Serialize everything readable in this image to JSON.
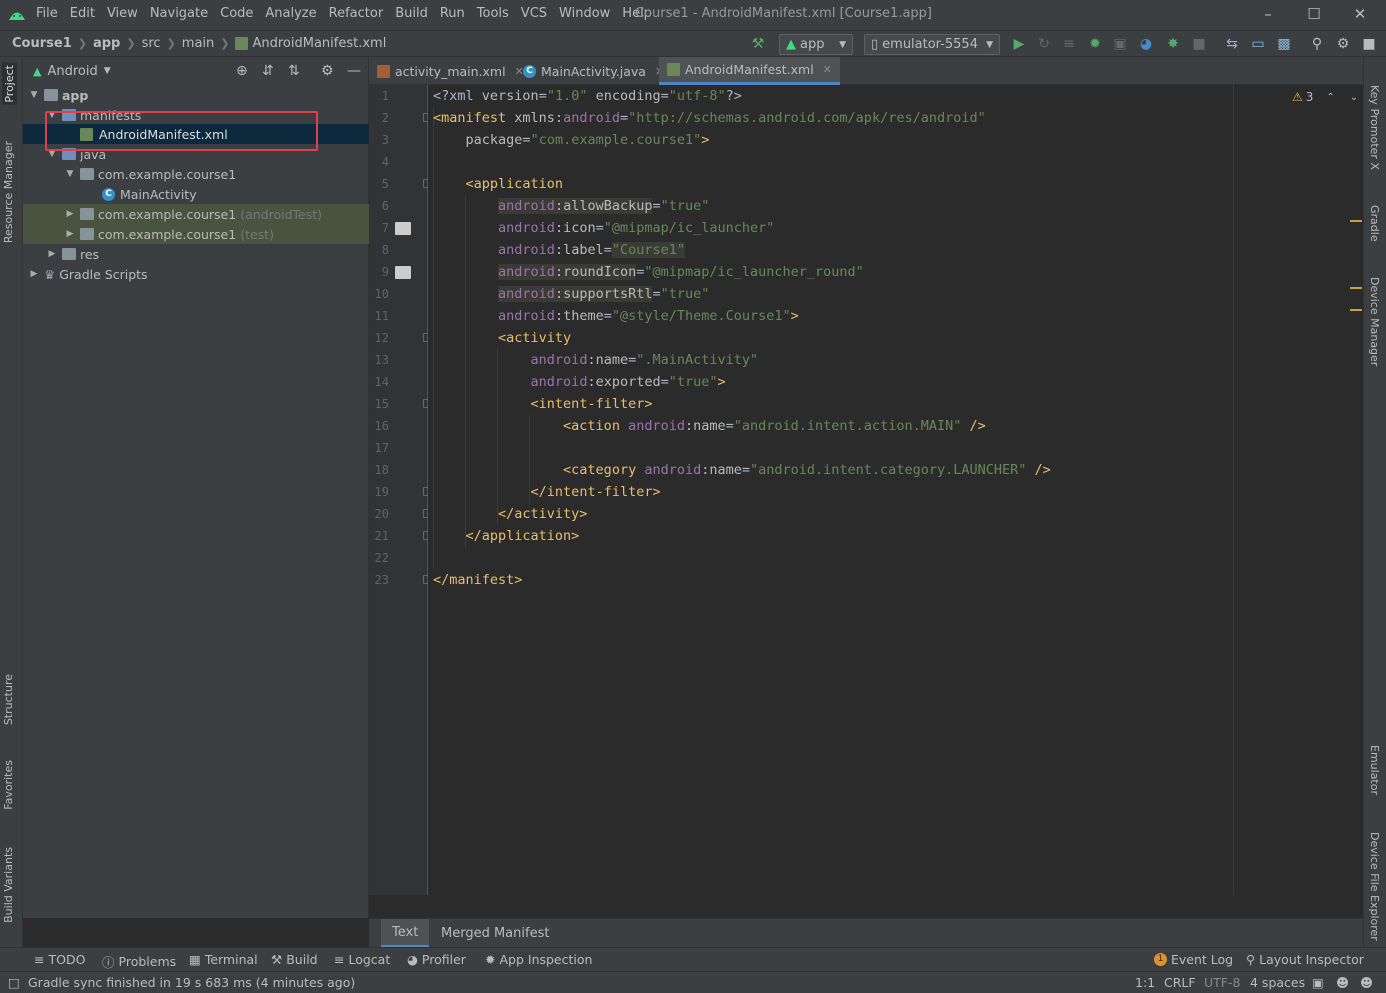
{
  "window": {
    "title": "Course1 - AndroidManifest.xml [Course1.app]",
    "menu": [
      "File",
      "Edit",
      "View",
      "Navigate",
      "Code",
      "Analyze",
      "Refactor",
      "Build",
      "Run",
      "Tools",
      "VCS",
      "Window",
      "Help"
    ]
  },
  "navbar": {
    "breadcrumbs": [
      "Course1",
      "app",
      "src",
      "main",
      "AndroidManifest.xml"
    ],
    "run_config": "app",
    "device": "emulator-5554"
  },
  "left_stripe": {
    "project": "Project",
    "resource_manager": "Resource Manager",
    "structure": "Structure",
    "favorites": "Favorites",
    "build_variants": "Build Variants"
  },
  "right_stripe": {
    "key_promoter": "Key Promoter X",
    "gradle": "Gradle",
    "device_manager": "Device Manager",
    "emulator": "Emulator",
    "device_file_explorer": "Device File Explorer"
  },
  "project": {
    "view_mode": "Android",
    "tree": {
      "app": "app",
      "manifests": "manifests",
      "manifest_file": "AndroidManifest.xml",
      "java": "java",
      "pkg_main": "com.example.course1",
      "main_activity": "MainActivity",
      "pkg_android_test": "com.example.course1",
      "pkg_android_test_tag": "(androidTest)",
      "pkg_test": "com.example.course1",
      "pkg_test_tag": "(test)",
      "res": "res",
      "gradle_scripts": "Gradle Scripts"
    }
  },
  "editor": {
    "tabs": [
      {
        "label": "activity_main.xml"
      },
      {
        "label": "MainActivity.java"
      },
      {
        "label": "AndroidManifest.xml"
      }
    ],
    "warnings_count": "3",
    "line_numbers": [
      "1",
      "2",
      "3",
      "4",
      "5",
      "6",
      "7",
      "8",
      "9",
      "10",
      "11",
      "12",
      "13",
      "14",
      "15",
      "16",
      "17",
      "18",
      "19",
      "20",
      "21",
      "22",
      "23"
    ],
    "bottom_tabs": {
      "text": "Text",
      "merged": "Merged Manifest"
    }
  },
  "code": {
    "l1_a": "<?xml ",
    "l1_b": "version",
    "l1_c": "=",
    "l1_d": "\"1.0\"",
    "l1_e": " encoding",
    "l1_f": "=",
    "l1_g": "\"utf-8\"",
    "l1_h": "?>",
    "l2_a": "<manifest ",
    "l2_b": "xmlns:",
    "l2_c": "android",
    "l2_d": "=",
    "l2_e": "\"http://schemas.android.com/apk/res/android\"",
    "l3_a": "package",
    "l3_b": "=",
    "l3_c": "\"com.example.course1\"",
    "l3_d": ">",
    "l5": "<application",
    "l6_a": "android",
    "l6_b": ":allowBackup",
    "l6_c": "=",
    "l6_d": "\"true\"",
    "l7_a": "android",
    "l7_b": ":icon",
    "l7_c": "=",
    "l7_d": "\"@mipmap/ic_launcher\"",
    "l8_a": "android",
    "l8_b": ":label",
    "l8_c": "=",
    "l8_d": "\"Course1\"",
    "l9_a": "android",
    "l9_b": ":roundIcon",
    "l9_c": "=",
    "l9_d": "\"@mipmap/ic_launcher_round\"",
    "l10_a": "android",
    "l10_b": ":supportsRtl",
    "l10_c": "=",
    "l10_d": "\"true\"",
    "l11_a": "android",
    "l11_b": ":theme",
    "l11_c": "=",
    "l11_d": "\"@style/Theme.Course1\"",
    "l11_e": ">",
    "l12": "<activity",
    "l13_a": "android",
    "l13_b": ":name",
    "l13_c": "=",
    "l13_d": "\".MainActivity\"",
    "l14_a": "android",
    "l14_b": ":exported",
    "l14_c": "=",
    "l14_d": "\"true\"",
    "l14_e": ">",
    "l15": "<intent-filter>",
    "l16_a": "<action ",
    "l16_b": "android",
    "l16_c": ":name",
    "l16_d": "=",
    "l16_e": "\"android.intent.action.MAIN\"",
    "l16_f": " />",
    "l18_a": "<category ",
    "l18_b": "android",
    "l18_c": ":name",
    "l18_d": "=",
    "l18_e": "\"android.intent.category.LAUNCHER\"",
    "l18_f": " />",
    "l19": "</intent-filter>",
    "l20": "</activity>",
    "l21": "</application>",
    "l23": "</manifest>"
  },
  "tool_windows": {
    "todo": "TODO",
    "problems": "Problems",
    "terminal": "Terminal",
    "build": "Build",
    "logcat": "Logcat",
    "profiler": "Profiler",
    "app_inspection": "App Inspection",
    "event_log": "Event Log",
    "layout_inspector": "Layout Inspector",
    "event_log_count": "1"
  },
  "status": {
    "message": "Gradle sync finished in 19 s 683 ms (4 minutes ago)",
    "position": "1:1",
    "line_sep": "CRLF",
    "encoding": "UTF-8",
    "indent": "4 spaces"
  },
  "colors": {
    "accent": "#4a88c7",
    "highlight_box": "#e0404e",
    "tag": "#e8bf6a",
    "value": "#6a8759",
    "namespace": "#9876aa"
  }
}
